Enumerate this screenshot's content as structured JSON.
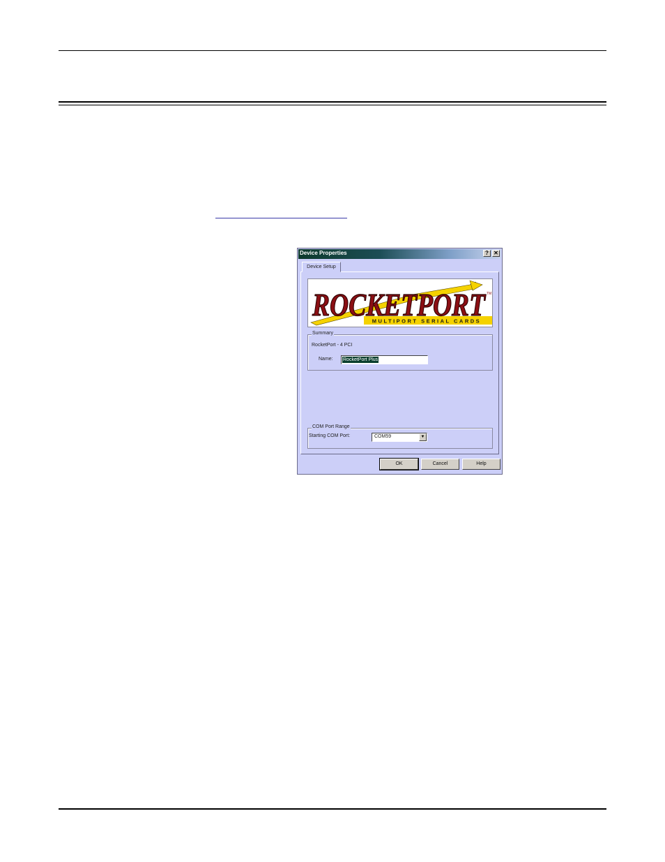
{
  "dialog": {
    "title": "Device Properties",
    "title_buttons": {
      "help": "?",
      "close": "✕"
    },
    "tab": "Device Setup",
    "banner": {
      "logo_text": "ROCKETPORT",
      "tagline": "MULTIPORT SERIAL CARDS",
      "trademark": "TM"
    },
    "summary": {
      "legend": "Summary",
      "device": "RocketPort - 4 PCI",
      "name_label": "Name:",
      "name_value": "RocketPort Plus"
    },
    "com_range": {
      "legend": "COM Port Range",
      "label": "Starting COM Port:",
      "value": "COM59"
    },
    "buttons": {
      "ok": "OK",
      "cancel": "Cancel",
      "help": "Help"
    }
  },
  "colors": {
    "dialog_bg": "#cccff8",
    "titlebar_dark": "#0d3a2c",
    "logo_red": "#8b0f14",
    "logo_yellow": "#f5d200"
  }
}
